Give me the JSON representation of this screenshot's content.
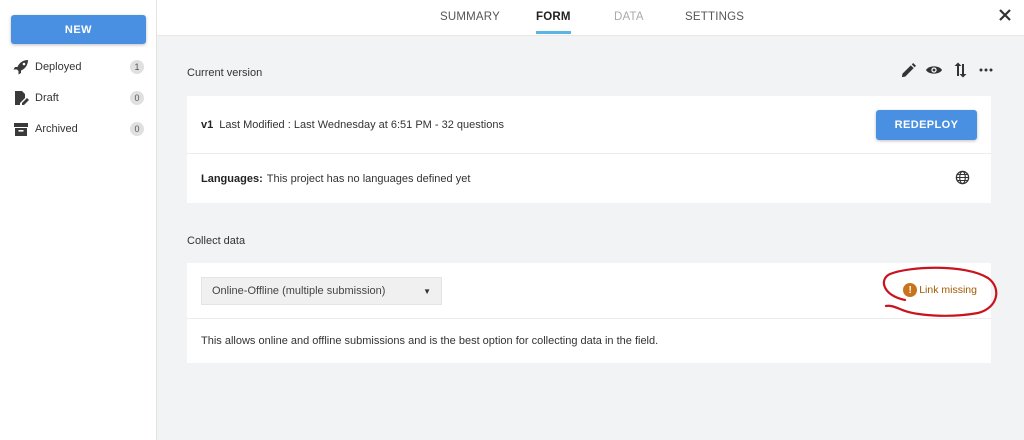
{
  "sidebar": {
    "new_label": "NEW",
    "items": [
      {
        "label": "Deployed",
        "count": "1",
        "icon": "rocket-icon"
      },
      {
        "label": "Draft",
        "count": "0",
        "icon": "draft-edit-icon"
      },
      {
        "label": "Archived",
        "count": "0",
        "icon": "archive-box-icon"
      }
    ]
  },
  "tabs": {
    "summary": "SUMMARY",
    "form": "FORM",
    "data": "DATA",
    "settings": "SETTINGS",
    "active": "FORM"
  },
  "current_version": {
    "title": "Current version",
    "version": "v1",
    "modified": "Last Modified : Last Wednesday at 6:51 PM - 32 questions",
    "redeploy_label": "REDEPLOY",
    "languages_label": "Languages:",
    "languages_text": "This project has no languages defined yet"
  },
  "collect_data": {
    "title": "Collect data",
    "selected_option": "Online-Offline (multiple submission)",
    "link_status": "Link missing",
    "description": "This allows online and offline submissions and is the best option for collecting data in the field."
  },
  "colors": {
    "primary": "#4a90e2",
    "active_tab_underline": "#5ab4e6",
    "warning": "#c8741c",
    "annotation": "#c8141c"
  }
}
